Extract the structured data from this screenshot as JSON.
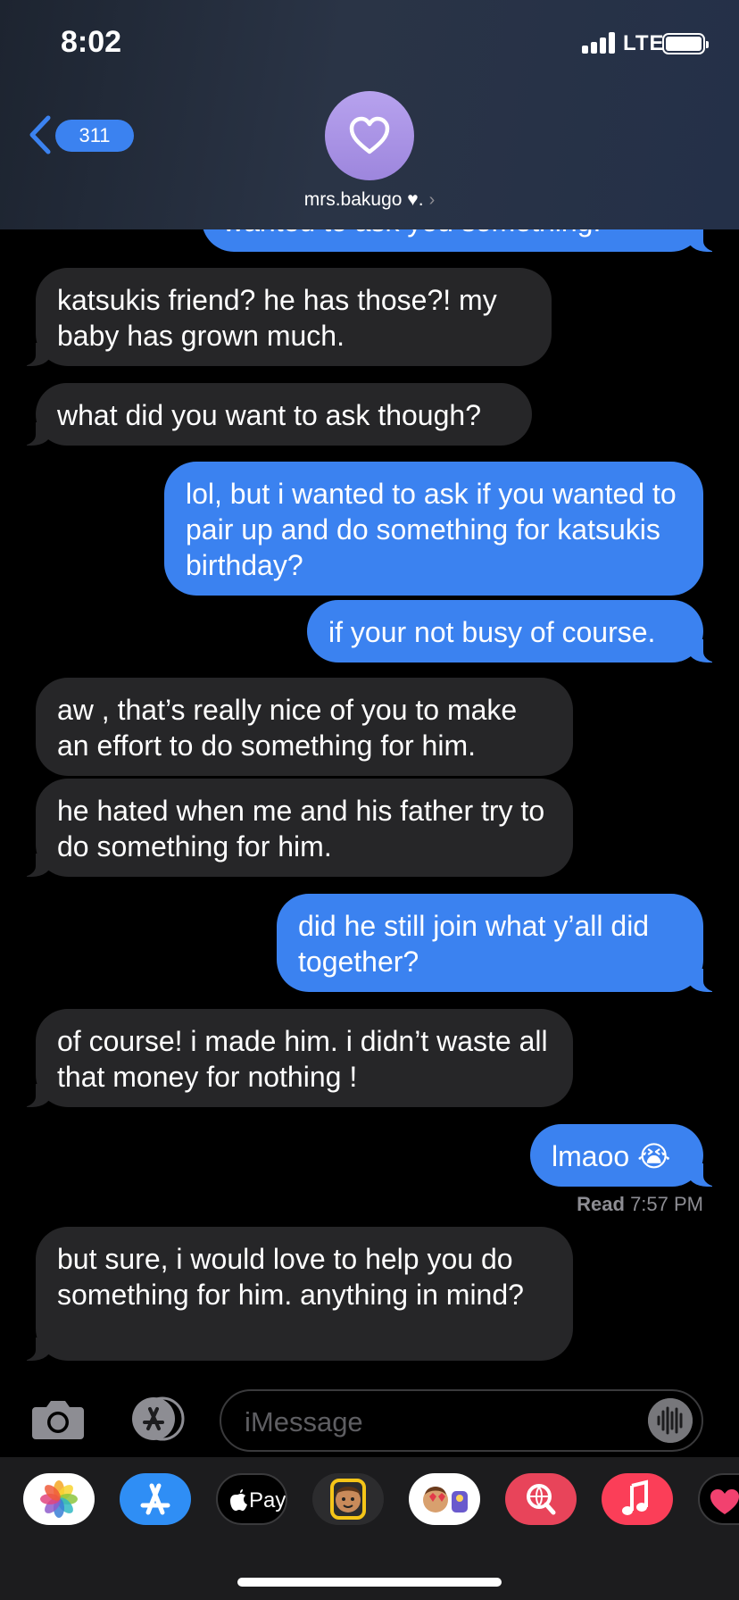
{
  "status_bar": {
    "time": "8:02",
    "network": "LTE"
  },
  "header": {
    "back_count": "311",
    "contact_name": "mrs.bakugo ♥︎.",
    "name_chevron": "›"
  },
  "messages": [
    {
      "from": "me",
      "text": "wanted to ask you something."
    },
    {
      "from": "them",
      "text": "katsukis friend? he has those?! my baby has grown much."
    },
    {
      "from": "them",
      "text": "what did you want to ask though?"
    },
    {
      "from": "me",
      "text": "lol, but i wanted to ask if you wanted to pair up and do something for katsukis birthday?"
    },
    {
      "from": "me",
      "text": "if your not busy of course."
    },
    {
      "from": "them",
      "text": "aw , that’s really nice of you to make an effort to do something for him."
    },
    {
      "from": "them",
      "text": "he hated when me and his father try to do something for him."
    },
    {
      "from": "me",
      "text": "did he still join what y’all did together?"
    },
    {
      "from": "them",
      "text": "of course! i made him. i didn’t waste all that money for nothing !"
    },
    {
      "from": "me",
      "text": "lmaoo 😭"
    },
    {
      "from": "them",
      "text": "but sure, i would love to help you do something for him. anything in mind?"
    }
  ],
  "read_receipt": {
    "label": "Read",
    "time": "7:57 PM"
  },
  "compose": {
    "placeholder": "iMessage"
  },
  "app_drawer": {
    "apple_pay_label": "Pay",
    "apps": [
      "photos-icon",
      "app-store-icon",
      "apple-pay-icon",
      "memoji-icon",
      "animoji-icon",
      "image-search-icon",
      "music-icon",
      "digital-touch-icon"
    ]
  },
  "colors": {
    "outgoing": "#3b82f0",
    "incoming": "#262628",
    "avatar": "#a891e6"
  }
}
